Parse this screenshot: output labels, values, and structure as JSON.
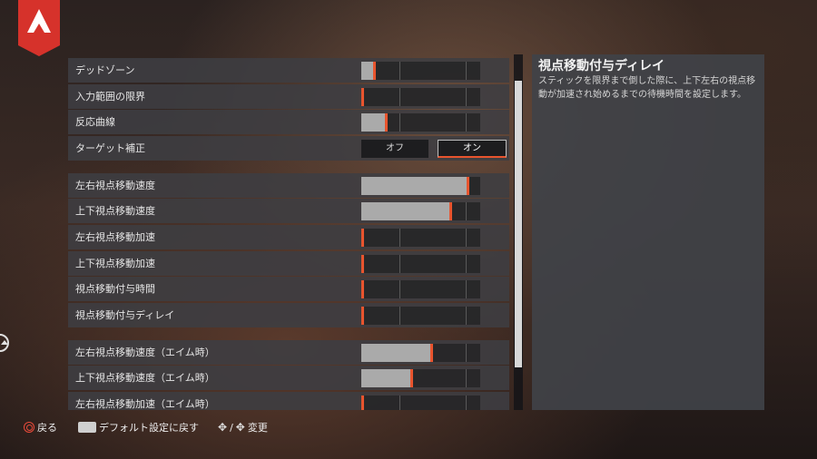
{
  "groups": [
    {
      "rows": [
        {
          "label": "デッドゾーン",
          "type": "slider",
          "value": 0.1
        },
        {
          "label": "入力範囲の限界",
          "type": "slider",
          "value": 0.0
        },
        {
          "label": "反応曲線",
          "type": "slider",
          "value": 0.2
        },
        {
          "label": "ターゲット補正",
          "type": "toggle",
          "options": [
            "オフ",
            "オン"
          ],
          "selected": 1
        }
      ]
    },
    {
      "rows": [
        {
          "label": "左右視点移動速度",
          "type": "slider",
          "value": 0.91
        },
        {
          "label": "上下視点移動速度",
          "type": "slider",
          "value": 0.76
        },
        {
          "label": "左右視点移動加速",
          "type": "slider",
          "value": 0.0
        },
        {
          "label": "上下視点移動加速",
          "type": "slider",
          "value": 0.0
        },
        {
          "label": "視点移動付与時間",
          "type": "slider",
          "value": 0.0
        },
        {
          "label": "視点移動付与ディレイ",
          "type": "slider",
          "value": 0.0
        }
      ]
    },
    {
      "rows": [
        {
          "label": "左右視点移動速度（エイム時）",
          "type": "slider",
          "value": 0.59
        },
        {
          "label": "上下視点移動速度（エイム時）",
          "type": "slider",
          "value": 0.42
        },
        {
          "label": "左右視点移動加速（エイム時）",
          "type": "slider",
          "value": 0.0
        }
      ]
    }
  ],
  "description": {
    "title": "視点移動付与ディレイ",
    "body": "スティックを限界まで倒した際に、上下左右の視点移動が加速され始めるまでの待機時間を設定します。"
  },
  "footer": {
    "back": "戻る",
    "reset": "デフォルト設定に戻す",
    "change_sep": "/",
    "change": "変更"
  },
  "colors": {
    "accent": "#e8542e",
    "fill": "#aaaaaa",
    "logo": "#d6322b"
  },
  "icons": {
    "logo": "apex-logo-icon",
    "back": "circle-button-icon",
    "reset": "touchpad-button-icon",
    "change": "dpad-icon"
  }
}
